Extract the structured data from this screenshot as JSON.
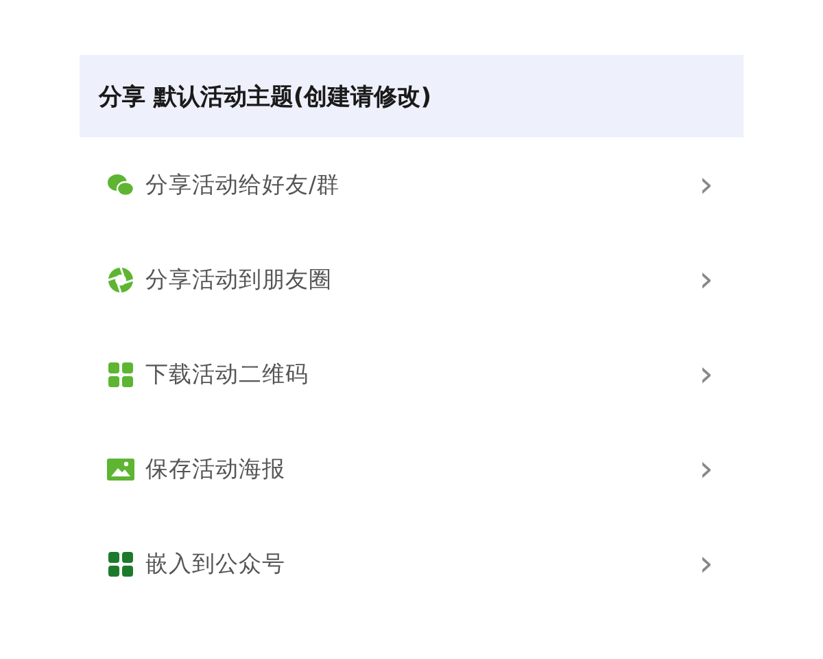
{
  "header": {
    "title": "分享 默认活动主题(创建请修改)"
  },
  "items": [
    {
      "kind": "wechat",
      "label": "分享活动给好友/群",
      "chevron": "›"
    },
    {
      "kind": "moments",
      "label": "分享活动到朋友圈",
      "chevron": "›"
    },
    {
      "kind": "qrcode",
      "label": "下载活动二维码",
      "chevron": "›"
    },
    {
      "kind": "poster",
      "label": "保存活动海报",
      "chevron": "›"
    },
    {
      "kind": "embed",
      "label": "嵌入到公众号",
      "chevron": "›"
    }
  ]
}
